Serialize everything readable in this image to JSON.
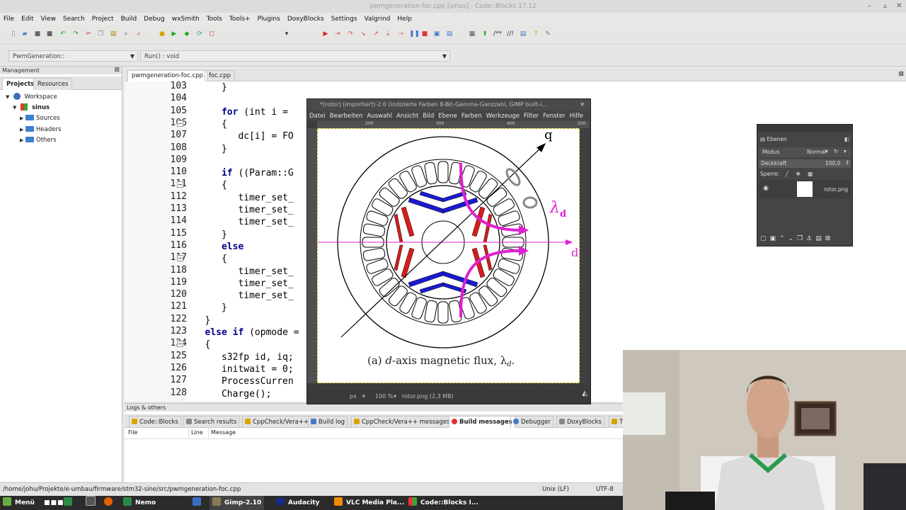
{
  "window": {
    "title": "pwmgeneration-foc.cpp [sinus] - Code::Blocks 17.12"
  },
  "menu": [
    "File",
    "Edit",
    "View",
    "Search",
    "Project",
    "Build",
    "Debug",
    "wxSmith",
    "Tools",
    "Tools+",
    "Plugins",
    "DoxyBlocks",
    "Settings",
    "Valgrind",
    "Help"
  ],
  "scope_combo": "PwmGeneration::",
  "function_combo": "Run() : void",
  "management": {
    "header": "Management",
    "tabs": [
      "Projects",
      "Resources"
    ],
    "tree": {
      "workspace": "Workspace",
      "project": "sinus",
      "folders": [
        "Sources",
        "Headers",
        "Others"
      ]
    }
  },
  "editor": {
    "tabs": [
      "pwmgeneration-foc.cpp",
      "foc.cpp"
    ],
    "line_numbers": [
      "103",
      "104",
      "105",
      "106",
      "107",
      "108",
      "109",
      "110",
      "111",
      "112",
      "113",
      "114",
      "115",
      "116",
      "117",
      "118",
      "119",
      "120",
      "121",
      "122",
      "123",
      "124",
      "125",
      "126",
      "127",
      "128"
    ],
    "lines": [
      {
        "pre": "      ",
        "kw": "",
        "rest": "}"
      },
      {
        "pre": "",
        "kw": "",
        "rest": ""
      },
      {
        "pre": "      ",
        "kw": "for",
        "rest": " (int i = "
      },
      {
        "pre": "      ",
        "kw": "",
        "rest": "{"
      },
      {
        "pre": "         ",
        "kw": "",
        "rest": "dc[i] = FO"
      },
      {
        "pre": "      ",
        "kw": "",
        "rest": "}"
      },
      {
        "pre": "",
        "kw": "",
        "rest": ""
      },
      {
        "pre": "      ",
        "kw": "if",
        "rest": " ((Param::G"
      },
      {
        "pre": "      ",
        "kw": "",
        "rest": "{"
      },
      {
        "pre": "         ",
        "kw": "",
        "rest": "timer_set_"
      },
      {
        "pre": "         ",
        "kw": "",
        "rest": "timer_set_"
      },
      {
        "pre": "         ",
        "kw": "",
        "rest": "timer_set_"
      },
      {
        "pre": "      ",
        "kw": "",
        "rest": "}"
      },
      {
        "pre": "      ",
        "kw": "else",
        "rest": ""
      },
      {
        "pre": "      ",
        "kw": "",
        "rest": "{"
      },
      {
        "pre": "         ",
        "kw": "",
        "rest": "timer_set_"
      },
      {
        "pre": "         ",
        "kw": "",
        "rest": "timer_set_"
      },
      {
        "pre": "         ",
        "kw": "",
        "rest": "timer_set_"
      },
      {
        "pre": "      ",
        "kw": "",
        "rest": "}"
      },
      {
        "pre": "   ",
        "kw": "",
        "rest": "}"
      },
      {
        "pre": "   ",
        "kw": "else if",
        "rest": " (opmode ="
      },
      {
        "pre": "   ",
        "kw": "",
        "rest": "{"
      },
      {
        "pre": "      ",
        "kw": "",
        "rest": "s32fp id, iq;"
      },
      {
        "pre": "      ",
        "kw": "",
        "rest": "initwait = 0;"
      },
      {
        "pre": "      ",
        "kw": "",
        "rest": "ProcessCurren"
      },
      {
        "pre": "      ",
        "kw": "",
        "rest": "Charge();"
      }
    ]
  },
  "logs": {
    "header": "Logs & others",
    "tabs": [
      "Code::Blocks",
      "Search results",
      "CppCheck/Vera++",
      "Build log",
      "CppCheck/Vera++ messages",
      "Build messages",
      "Debugger",
      "DoxyBlocks",
      "T"
    ],
    "columns": [
      "File",
      "Line",
      "Message"
    ]
  },
  "status": {
    "path": "/home/johu/Projekte/e-umbau/firmware/stm32-sine/src/pwmgeneration-foc.cpp",
    "eol": "Unix (LF)",
    "encoding": "UTF-8"
  },
  "taskbar": {
    "menu": "Menü",
    "apps": [
      "Nemo",
      "Gimp-2.10",
      "Audacity",
      "VLC Media Pla...",
      "Code::Blocks I..."
    ]
  },
  "gimp": {
    "title": "*[rotor] (importiert)-2.0 (Indizierte Farben 8-Bit-Gamma-Ganzzahl, GIMP built-i...",
    "menu": [
      "Datei",
      "Bearbeiten",
      "Auswahl",
      "Ansicht",
      "Bild",
      "Ebene",
      "Farben",
      "Werkzeuge",
      "Filter",
      "Fenster",
      "Hilfe"
    ],
    "ruler_ticks": [
      "200",
      "300",
      "400",
      "500"
    ],
    "figure": {
      "caption_prefix": "(a) ",
      "caption_d": "d",
      "caption_rest": "-axis magnetic flux, λ",
      "caption_sub": "d",
      "caption_end": ".",
      "q_label": "q",
      "d_label": "d",
      "lambda_label": "λ",
      "lambda_sub": "d"
    },
    "unit": "px",
    "zoom": "100 %",
    "file_info": "rotor.png (2,3 MB)"
  },
  "layers": {
    "header": "Ebenen",
    "mode_label": "Modus",
    "mode_value": "Normal",
    "opacity_label": "Deckkraft",
    "opacity_value": "100,0",
    "lock_label": "Sperre:",
    "layer_name": "rotor.png"
  },
  "colors": {
    "magenta": "#e11fd3",
    "red": "#d81c1c",
    "blue": "#1a1ad0",
    "keyword": "#00008b"
  }
}
